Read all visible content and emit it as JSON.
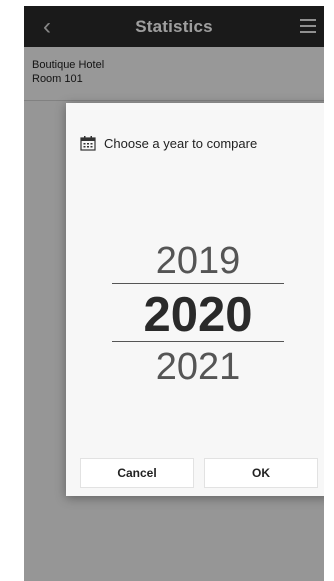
{
  "topbar": {
    "title": "Statistics",
    "back_icon": "chevron-left-icon",
    "menu_icon": "hamburger-menu-icon"
  },
  "hotel": {
    "name": "Boutique Hotel",
    "room": "Room 101"
  },
  "dialog": {
    "icon": "calendar-icon",
    "title": "Choose a year to compare",
    "years": {
      "prev": "2019",
      "selected": "2020",
      "next": "2021"
    },
    "cancel_label": "Cancel",
    "ok_label": "OK"
  },
  "colors": {
    "topbar": "#2b2b2b",
    "accent": "#2f8fb4"
  }
}
